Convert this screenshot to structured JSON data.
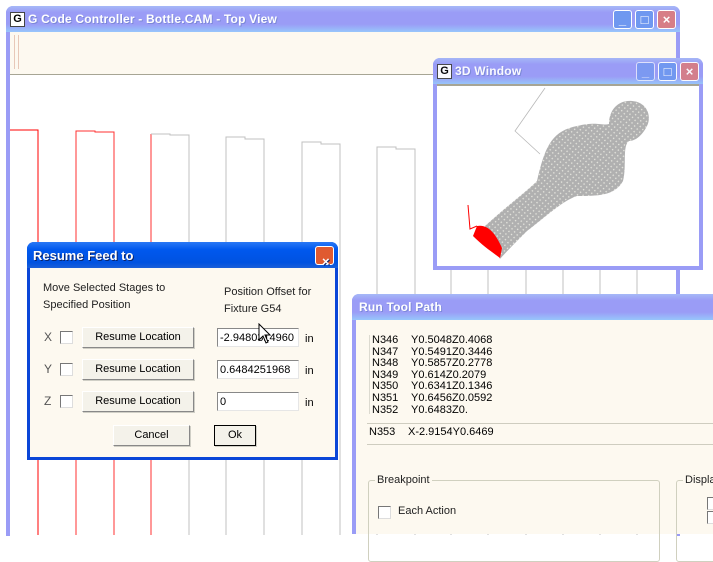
{
  "main_window": {
    "title": "G Code Controller - Bottle.CAM - Top View",
    "app_icon": "G",
    "caption_buttons": {
      "minimize": "_",
      "maximize": "□",
      "close": "×"
    }
  },
  "window_3d": {
    "title": "3D Window",
    "app_icon": "G",
    "caption_buttons": {
      "minimize": "_",
      "maximize": "□",
      "close": "×"
    }
  },
  "resume_dialog": {
    "title": "Resume Feed to",
    "close": "×",
    "instruction_line1": "Move Selected Stages to",
    "instruction_line2": "Specified Position",
    "offset_label_line1": "Position Offset for",
    "offset_label_line2": "Fixture G54",
    "axes": [
      {
        "axis": "X",
        "checked": false,
        "button": "Resume Location",
        "value": "-2.9480314960",
        "unit": "in"
      },
      {
        "axis": "Y",
        "checked": false,
        "button": "Resume Location",
        "value": "0.6484251968",
        "unit": "in"
      },
      {
        "axis": "Z",
        "checked": false,
        "button": "Resume Location",
        "value": "0",
        "unit": "in"
      }
    ],
    "cancel_label": "Cancel",
    "ok_label": "Ok"
  },
  "run_tool_path": {
    "title": "Run Tool Path",
    "code_lines": [
      {
        "n": "N346",
        "code": "Y0.5048Z0.4068"
      },
      {
        "n": "N347",
        "code": "Y0.5491Z0.3446"
      },
      {
        "n": "N348",
        "code": "Y0.5857Z0.2778"
      },
      {
        "n": "N349",
        "code": "Y0.614Z0.2079"
      },
      {
        "n": "N350",
        "code": "Y0.6341Z0.1346"
      },
      {
        "n": "N351",
        "code": "Y0.6456Z0.0592"
      },
      {
        "n": "N352",
        "code": "Y0.6483Z0."
      }
    ],
    "current_line": {
      "n": "N353",
      "code": "X-2.9154Y0.6469"
    },
    "breakpoint_group": "Breakpoint",
    "each_action_label": "Each Action",
    "each_action_checked": false,
    "display_group": "Displa"
  },
  "colors": {
    "title_bar_inactive": "#9a9cf6",
    "dialog_title_active": "#0058ee",
    "toolpath_done": "#ff0000",
    "toolpath_pending": "#c0c0c0",
    "window_face": "#fdf9f0"
  }
}
